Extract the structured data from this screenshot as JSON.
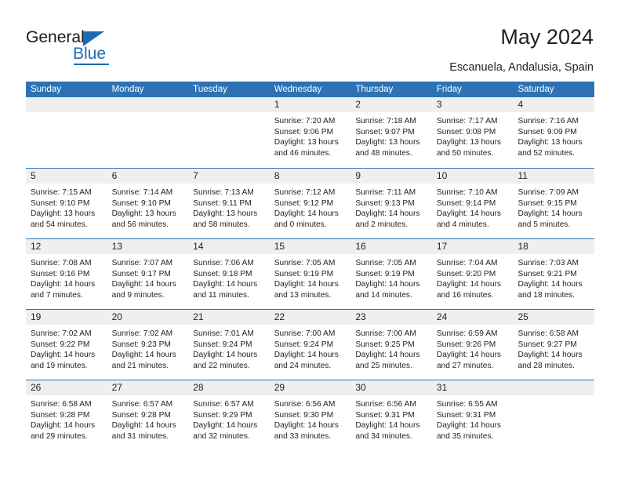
{
  "brand": {
    "name_top": "General",
    "name_bottom": "Blue",
    "accent_color": "#1b6cb0"
  },
  "header": {
    "title": "May 2024",
    "subtitle": "Escanuela, Andalusia, Spain"
  },
  "theme": {
    "header_band_color": "#2c72b4",
    "day_number_band_color": "#efefef",
    "text_color": "#231f20"
  },
  "weekdays": [
    "Sunday",
    "Monday",
    "Tuesday",
    "Wednesday",
    "Thursday",
    "Friday",
    "Saturday"
  ],
  "weeks": [
    [
      {
        "day": "",
        "lines": []
      },
      {
        "day": "",
        "lines": []
      },
      {
        "day": "",
        "lines": []
      },
      {
        "day": "1",
        "lines": [
          "Sunrise: 7:20 AM",
          "Sunset: 9:06 PM",
          "Daylight: 13 hours",
          "and 46 minutes."
        ]
      },
      {
        "day": "2",
        "lines": [
          "Sunrise: 7:18 AM",
          "Sunset: 9:07 PM",
          "Daylight: 13 hours",
          "and 48 minutes."
        ]
      },
      {
        "day": "3",
        "lines": [
          "Sunrise: 7:17 AM",
          "Sunset: 9:08 PM",
          "Daylight: 13 hours",
          "and 50 minutes."
        ]
      },
      {
        "day": "4",
        "lines": [
          "Sunrise: 7:16 AM",
          "Sunset: 9:09 PM",
          "Daylight: 13 hours",
          "and 52 minutes."
        ]
      }
    ],
    [
      {
        "day": "5",
        "lines": [
          "Sunrise: 7:15 AM",
          "Sunset: 9:10 PM",
          "Daylight: 13 hours",
          "and 54 minutes."
        ]
      },
      {
        "day": "6",
        "lines": [
          "Sunrise: 7:14 AM",
          "Sunset: 9:10 PM",
          "Daylight: 13 hours",
          "and 56 minutes."
        ]
      },
      {
        "day": "7",
        "lines": [
          "Sunrise: 7:13 AM",
          "Sunset: 9:11 PM",
          "Daylight: 13 hours",
          "and 58 minutes."
        ]
      },
      {
        "day": "8",
        "lines": [
          "Sunrise: 7:12 AM",
          "Sunset: 9:12 PM",
          "Daylight: 14 hours",
          "and 0 minutes."
        ]
      },
      {
        "day": "9",
        "lines": [
          "Sunrise: 7:11 AM",
          "Sunset: 9:13 PM",
          "Daylight: 14 hours",
          "and 2 minutes."
        ]
      },
      {
        "day": "10",
        "lines": [
          "Sunrise: 7:10 AM",
          "Sunset: 9:14 PM",
          "Daylight: 14 hours",
          "and 4 minutes."
        ]
      },
      {
        "day": "11",
        "lines": [
          "Sunrise: 7:09 AM",
          "Sunset: 9:15 PM",
          "Daylight: 14 hours",
          "and 5 minutes."
        ]
      }
    ],
    [
      {
        "day": "12",
        "lines": [
          "Sunrise: 7:08 AM",
          "Sunset: 9:16 PM",
          "Daylight: 14 hours",
          "and 7 minutes."
        ]
      },
      {
        "day": "13",
        "lines": [
          "Sunrise: 7:07 AM",
          "Sunset: 9:17 PM",
          "Daylight: 14 hours",
          "and 9 minutes."
        ]
      },
      {
        "day": "14",
        "lines": [
          "Sunrise: 7:06 AM",
          "Sunset: 9:18 PM",
          "Daylight: 14 hours",
          "and 11 minutes."
        ]
      },
      {
        "day": "15",
        "lines": [
          "Sunrise: 7:05 AM",
          "Sunset: 9:19 PM",
          "Daylight: 14 hours",
          "and 13 minutes."
        ]
      },
      {
        "day": "16",
        "lines": [
          "Sunrise: 7:05 AM",
          "Sunset: 9:19 PM",
          "Daylight: 14 hours",
          "and 14 minutes."
        ]
      },
      {
        "day": "17",
        "lines": [
          "Sunrise: 7:04 AM",
          "Sunset: 9:20 PM",
          "Daylight: 14 hours",
          "and 16 minutes."
        ]
      },
      {
        "day": "18",
        "lines": [
          "Sunrise: 7:03 AM",
          "Sunset: 9:21 PM",
          "Daylight: 14 hours",
          "and 18 minutes."
        ]
      }
    ],
    [
      {
        "day": "19",
        "lines": [
          "Sunrise: 7:02 AM",
          "Sunset: 9:22 PM",
          "Daylight: 14 hours",
          "and 19 minutes."
        ]
      },
      {
        "day": "20",
        "lines": [
          "Sunrise: 7:02 AM",
          "Sunset: 9:23 PM",
          "Daylight: 14 hours",
          "and 21 minutes."
        ]
      },
      {
        "day": "21",
        "lines": [
          "Sunrise: 7:01 AM",
          "Sunset: 9:24 PM",
          "Daylight: 14 hours",
          "and 22 minutes."
        ]
      },
      {
        "day": "22",
        "lines": [
          "Sunrise: 7:00 AM",
          "Sunset: 9:24 PM",
          "Daylight: 14 hours",
          "and 24 minutes."
        ]
      },
      {
        "day": "23",
        "lines": [
          "Sunrise: 7:00 AM",
          "Sunset: 9:25 PM",
          "Daylight: 14 hours",
          "and 25 minutes."
        ]
      },
      {
        "day": "24",
        "lines": [
          "Sunrise: 6:59 AM",
          "Sunset: 9:26 PM",
          "Daylight: 14 hours",
          "and 27 minutes."
        ]
      },
      {
        "day": "25",
        "lines": [
          "Sunrise: 6:58 AM",
          "Sunset: 9:27 PM",
          "Daylight: 14 hours",
          "and 28 minutes."
        ]
      }
    ],
    [
      {
        "day": "26",
        "lines": [
          "Sunrise: 6:58 AM",
          "Sunset: 9:28 PM",
          "Daylight: 14 hours",
          "and 29 minutes."
        ]
      },
      {
        "day": "27",
        "lines": [
          "Sunrise: 6:57 AM",
          "Sunset: 9:28 PM",
          "Daylight: 14 hours",
          "and 31 minutes."
        ]
      },
      {
        "day": "28",
        "lines": [
          "Sunrise: 6:57 AM",
          "Sunset: 9:29 PM",
          "Daylight: 14 hours",
          "and 32 minutes."
        ]
      },
      {
        "day": "29",
        "lines": [
          "Sunrise: 6:56 AM",
          "Sunset: 9:30 PM",
          "Daylight: 14 hours",
          "and 33 minutes."
        ]
      },
      {
        "day": "30",
        "lines": [
          "Sunrise: 6:56 AM",
          "Sunset: 9:31 PM",
          "Daylight: 14 hours",
          "and 34 minutes."
        ]
      },
      {
        "day": "31",
        "lines": [
          "Sunrise: 6:55 AM",
          "Sunset: 9:31 PM",
          "Daylight: 14 hours",
          "and 35 minutes."
        ]
      },
      {
        "day": "",
        "lines": []
      }
    ]
  ]
}
